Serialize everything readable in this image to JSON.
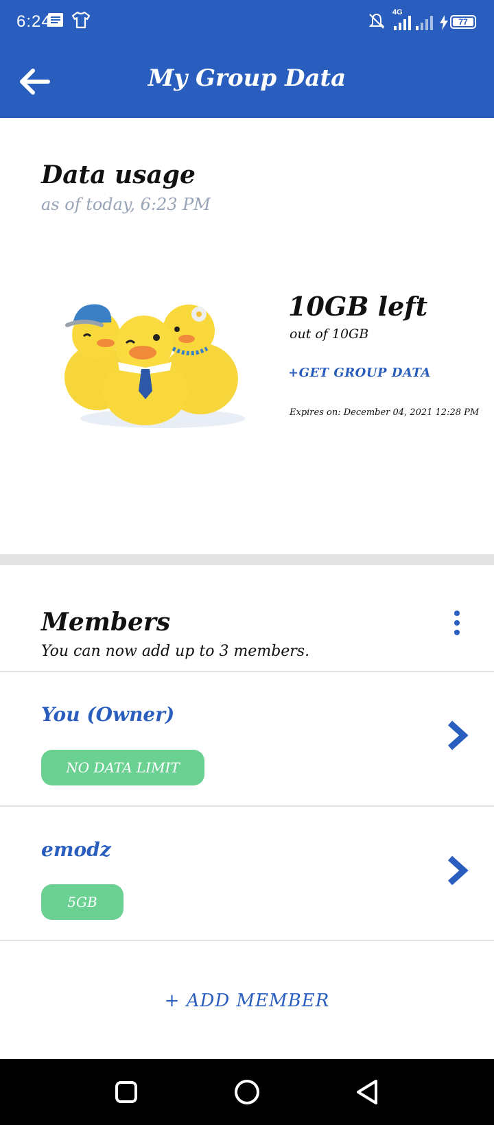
{
  "status": {
    "time": "6:24",
    "network": "4G",
    "battery": "77"
  },
  "header": {
    "title": "My Group Data"
  },
  "usage": {
    "title": "Data usage",
    "as_of": "as of today, 6:23 PM",
    "left": "10GB left",
    "out_of": "out of 10GB",
    "get_data": "+GET GROUP DATA",
    "expires": "Expires on: December 04, 2021 12:28 PM"
  },
  "members": {
    "title": "Members",
    "subtitle": "You can now add up to 3 members.",
    "items": [
      {
        "name": "You (Owner)",
        "badge": "NO DATA LIMIT"
      },
      {
        "name": "emodz",
        "badge": "5GB"
      }
    ],
    "add_label": "+ ADD MEMBER"
  },
  "colors": {
    "brand": "#2a5ebe",
    "badge": "#6bd193",
    "duck": "#f9d83c"
  }
}
